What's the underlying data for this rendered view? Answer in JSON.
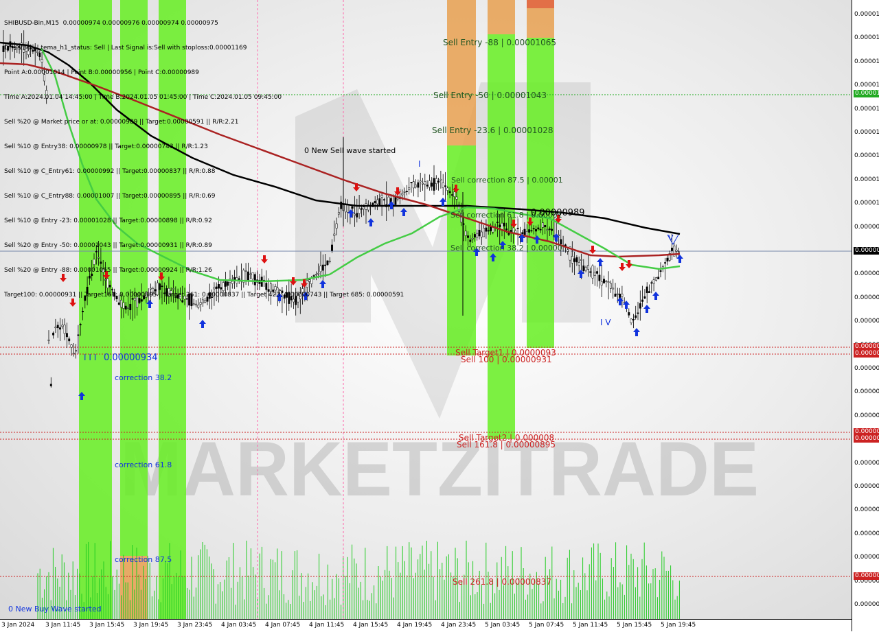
{
  "chart_data": {
    "type": "candlestick",
    "symbol": "SHIBUSD-Bin,M15",
    "header": "SHIBUSD-Bin,M15  0.00000974 0.00000976 0.00000974 0.00000975",
    "info_lines": [
      "Line:2865 | tema_h1_status: Sell | Last Signal is:Sell with stoploss:0.00001169",
      "Point A:0.00001014 | Point B:0.00000956 | Point C:0.00000989",
      "Time A:2024.01.04 14:45:00 | Time B:2024.01.05 01:45:00 | Time C:2024.01.05 09:45:00",
      "Sell %20 @ Market price or at: 0.00000989 || Target:0.00000591 || R/R:2.21",
      "Sell %10 @ Entry38: 0.00000978 || Target:0.00000743 || R/R:1.23",
      "Sell %10 @ C_Entry61: 0.00000992 || Target:0.00000837 || R/R:0.88",
      "Sell %10 @ C_Entry88: 0.00001007 || Target:0.00000895 || R/R:0.69",
      "Sell %10 @ Entry -23: 0.00001028 || Target:0.00000898 || R/R:0.92",
      "Sell %20 @ Entry -50: 0.00001043 || Target:0.00000931 || R/R:0.89",
      "Sell %20 @ Entry -88: 0.00001065 || Target:0.00000924 || R/R:1.26",
      "Target100: 0.00000931 || Target161: 0.00000895 || Target 261: 0.00000837 || Target 423: 0.00000743 || Target 685: 0.00000591"
    ],
    "price_ticks": [
      "0.00001",
      "0.00001",
      "0.00001",
      "0.00001",
      "0.00001",
      "0.00001",
      "0.00001",
      "0.00001",
      "0.00001",
      "0.000009",
      "0.000009",
      "0.000009",
      "0.000009",
      "0.000009",
      "0.000009",
      "0.000009",
      "0.000009",
      "0.000008",
      "0.000008",
      "0.000008",
      "0.000008",
      "0.000008",
      "0.000008",
      "0.000008",
      "0.000008",
      "0.000008"
    ],
    "price_boxes": [
      {
        "text": "0.000010",
        "color": "#22aa22"
      },
      {
        "text": "0.000009",
        "color": "#000000"
      },
      {
        "text": "0.000009",
        "color": "#cc2222"
      },
      {
        "text": "0.000009",
        "color": "#cc2222"
      },
      {
        "text": "0.000008",
        "color": "#cc2222"
      },
      {
        "text": "0.000008",
        "color": "#cc2222"
      },
      {
        "text": "0.000008",
        "color": "#cc2222"
      }
    ],
    "time_ticks": [
      "3 Jan 2024",
      "3 Jan 11:45",
      "3 Jan 15:45",
      "3 Jan 19:45",
      "3 Jan 23:45",
      "4 Jan 03:45",
      "4 Jan 07:45",
      "4 Jan 11:45",
      "4 Jan 15:45",
      "4 Jan 19:45",
      "4 Jan 23:45",
      "5 Jan 03:45",
      "5 Jan 07:45",
      "5 Jan 11:45",
      "5 Jan 15:45",
      "5 Jan 19:45"
    ],
    "annotations": {
      "sell_entry_88": "Sell Entry -88 | 0.00001065",
      "sell_entry_50": "Sell Entry -50 | 0.00001043",
      "sell_entry_23": "Sell Entry -23.6 | 0.00001028",
      "new_sell_wave": "0 New Sell wave started",
      "sell_corr_875": "Sell correction 87.5 | 0.00001",
      "sell_corr_618": "Sell correction 61.8 | 0.00001",
      "current_price_label": "0.00000989",
      "sell_corr_382": "Sell correction 38.2 | 0.00000",
      "wave_v_top": "V",
      "wave_iv": "I V",
      "wave_i": "I",
      "wave_iii": "I I I",
      "iii_price": "0.00000934",
      "correction_382": "correction 38.2",
      "correction_618": "correction 61.8",
      "correction_875": "correction 87.5",
      "new_buy_wave": "0 New Buy Wave started",
      "sell_target1": "Sell Target1 | 0.0000093",
      "sell_100": "Sell 100 | 0.00000931",
      "sell_target2": "Sell Target2 | 0.000008",
      "sell_1618": "Sell 161.8 | 0.00000895",
      "sell_2618": "Sell  261.8 | 0.00000837",
      "watermark": "MARKETZITRADE"
    },
    "moving_averages": [
      {
        "color": "#000000",
        "role": "slow MA"
      },
      {
        "color": "#aa2222",
        "role": "medium MA"
      },
      {
        "color": "#44cc44",
        "role": "fast MA"
      }
    ],
    "colors": {
      "buy_zone": "#66ee22",
      "sell_zone": "#e8a050",
      "sell_line": "#cc2222",
      "entry_line": "#22aa22",
      "buy_arrow": "#1133dd",
      "sell_arrow": "#dd1111"
    }
  }
}
